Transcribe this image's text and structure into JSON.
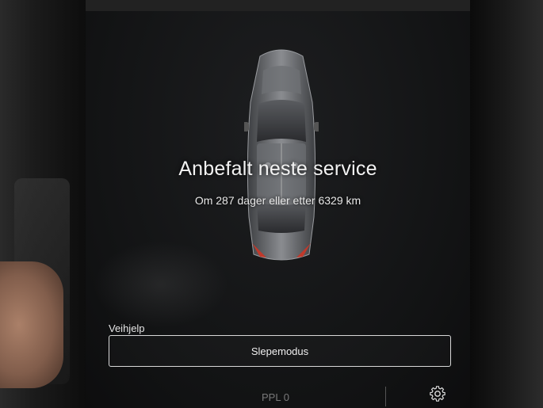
{
  "service": {
    "title": "Anbefalt neste service",
    "subtitle": "Om 287 dager eller etter 6329 km"
  },
  "assistance": {
    "section_label": "Veihjelp",
    "tow_mode_button": "Slepemodus"
  },
  "bottom_bar": {
    "partial_text": "PPL 0",
    "icons": [
      "settings-icon"
    ]
  },
  "colors": {
    "screen_background": "#121314",
    "text": "#f2f2f2",
    "tail_light": "#c0392b"
  }
}
